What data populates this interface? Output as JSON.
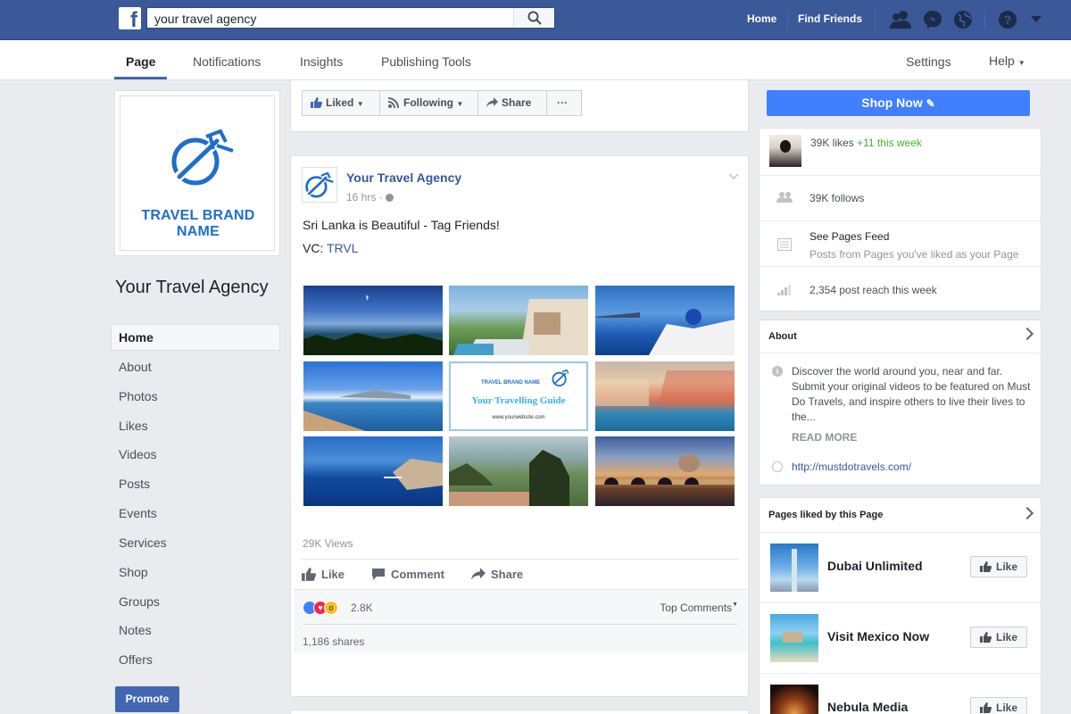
{
  "topbar": {
    "search_value": "your travel agency",
    "nav": [
      "Home",
      "Find Friends"
    ],
    "brand_color": "#3b5998"
  },
  "subnav": {
    "tabs": [
      "Page",
      "Notifications",
      "Insights",
      "Publishing Tools"
    ],
    "settings": "Settings",
    "help": "Help"
  },
  "left": {
    "profile_brand": "TRAVEL BRAND NAME",
    "page_name": "Your Travel Agency",
    "nav": [
      "Home",
      "About",
      "Photos",
      "Likes",
      "Videos",
      "Posts",
      "Events",
      "Services",
      "Shop",
      "Groups",
      "Notes",
      "Offers"
    ],
    "promote": "Promote"
  },
  "actions": {
    "liked": "Liked",
    "following": "Following",
    "share": "Share",
    "more": "···",
    "shop_now": "Shop Now"
  },
  "post": {
    "author": "Your Travel Agency",
    "time": "16 hrs ·",
    "text": "Sri Lanka is Beautiful - Tag Friends!",
    "vc_prefix": "VC: ",
    "vc_link": "TRVL",
    "center_tile": {
      "brand": "TRAVEL BRAND NAME",
      "title": "Your Travelling Guide",
      "url": "www.yourwebsite.com"
    },
    "views": "29K Views",
    "like": "Like",
    "comment": "Comment",
    "share": "Share",
    "reactions_count": "2.8K",
    "top_comments": "Top Comments",
    "shares": "1,186 shares"
  },
  "stats": {
    "likes": "39K likes",
    "likes_delta": "+11 this week",
    "follows": "39K follows",
    "feed_title": "See Pages Feed",
    "feed_sub": "Posts from Pages you've liked as your Page",
    "reach": "2,354 post reach this week"
  },
  "about": {
    "heading": "About",
    "description": "Discover the world around you, near and far. Submit your original videos to be featured on Must Do Travels, and inspire others to live their lives to the...",
    "read_more": "READ MORE",
    "website": "http://mustdotravels.com/"
  },
  "liked_pages": {
    "heading": "Pages liked by this Page",
    "like_label": "Like",
    "items": [
      "Dubai Unlimited",
      "Visit Mexico Now",
      "Nebula Media"
    ]
  }
}
